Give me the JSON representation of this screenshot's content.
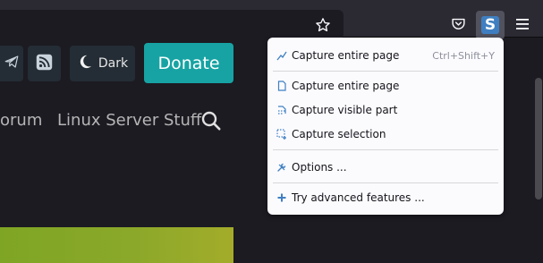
{
  "colors": {
    "toolbar_bg": "#2b2a33",
    "page_bg": "#1c1b22",
    "donate_bg": "#17a3a3",
    "icon_blue": "#3f7fc1",
    "menu_bg": "#fbfbfe"
  },
  "toolbar": {
    "bookmark_icon": "star-icon",
    "pocket_icon": "pocket-icon",
    "extension_icon": "screenshot-extension-icon",
    "menu_icon": "hamburger-menu-icon"
  },
  "menu": {
    "items": [
      {
        "label": "Capture entire page",
        "shortcut": "Ctrl+Shift+Y",
        "icon": "capture-graph-icon"
      },
      {
        "label": "Capture entire page",
        "icon": "page-icon"
      },
      {
        "label": "Capture visible part",
        "icon": "visible-part-icon"
      },
      {
        "label": "Capture selection",
        "icon": "selection-icon"
      },
      {
        "label": "Options ...",
        "icon": "tools-icon"
      },
      {
        "label": "Try advanced features ...",
        "icon": "plus-icon"
      }
    ]
  },
  "page": {
    "dark_label": "Dark",
    "donate_label": "Donate",
    "nav": {
      "forum": "orum",
      "linux_server": "Linux Server Stuff"
    }
  }
}
